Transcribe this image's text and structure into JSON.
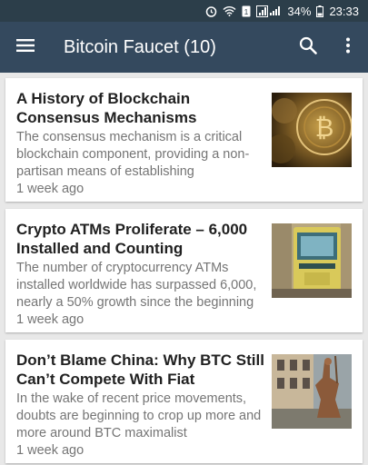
{
  "status_bar": {
    "battery": "34%",
    "time": "23:33",
    "icons": [
      "alarm-icon",
      "wifi-icon",
      "sim-icon",
      "signal-icon",
      "battery-icon"
    ]
  },
  "app_bar": {
    "title": "Bitcoin Faucet (10)",
    "background": "#34495e",
    "icons": [
      "menu-icon",
      "search-icon",
      "more-vertical-icon"
    ]
  },
  "articles": [
    {
      "title": "A History of Blockchain Consensus Mechanisms",
      "snippet": "The consensus mechanism is a critical blockchain component, providing a non-partisan means of establishing",
      "time": "1 week ago",
      "thumbnail": "golden-bitcoin-thumbnail"
    },
    {
      "title": "Crypto ATMs Proliferate – 6,000 Installed and Counting",
      "snippet": "The number of cryptocurrency ATMs installed worldwide has surpassed 6,000, nearly a 50% growth since the beginning",
      "time": "1 week ago",
      "thumbnail": "bitcoin-atm-thumbnail"
    },
    {
      "title": "Don’t Blame China: Why BTC Still Can’t Compete With Fiat",
      "snippet": "In the wake of recent price movements, doubts are beginning to crop up more and more around BTC maximalist",
      "time": "1 week ago",
      "thumbnail": "statue-thumbnail"
    }
  ]
}
